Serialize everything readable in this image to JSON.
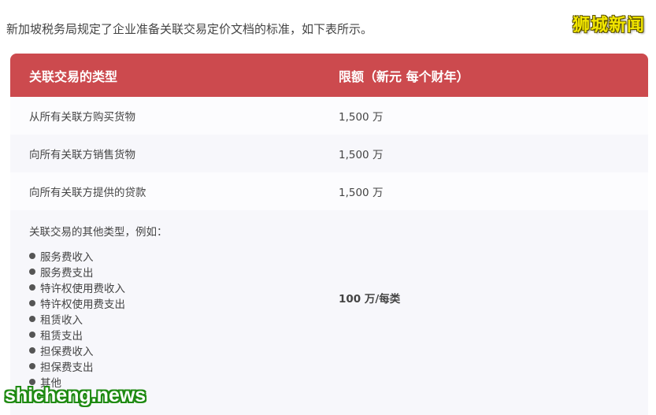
{
  "intro_text": "新加坡税务局规定了企业准备关联交易定价文档的标准，如下表所示。",
  "watermark_top": "狮城新闻",
  "watermark_bottom": "shicheng.news",
  "table": {
    "headers": [
      "关联交易的类型",
      "限额（新元 每个财年）"
    ],
    "rows": [
      {
        "type": "从所有关联方购买货物",
        "limit": "1,500 万"
      },
      {
        "type": "向所有关联方销售货物",
        "limit": "1,500 万"
      },
      {
        "type": "向所有关联方提供的贷款",
        "limit": "1,500 万"
      }
    ],
    "other": {
      "title": "关联交易的其他类型，例如：",
      "items": [
        "服务费收入",
        "服务费支出",
        "特许权使用费收入",
        "特许权使用费支出",
        "租赁收入",
        "租赁支出",
        "担保费收入",
        "担保费支出",
        "其他"
      ],
      "limit": "100 万/每类"
    }
  },
  "colors": {
    "header_bg": "#cc4a4e",
    "row_shade": "#f7f7fb",
    "watermark_yellow": "#f2e600",
    "watermark_green": "#1f8a12"
  }
}
